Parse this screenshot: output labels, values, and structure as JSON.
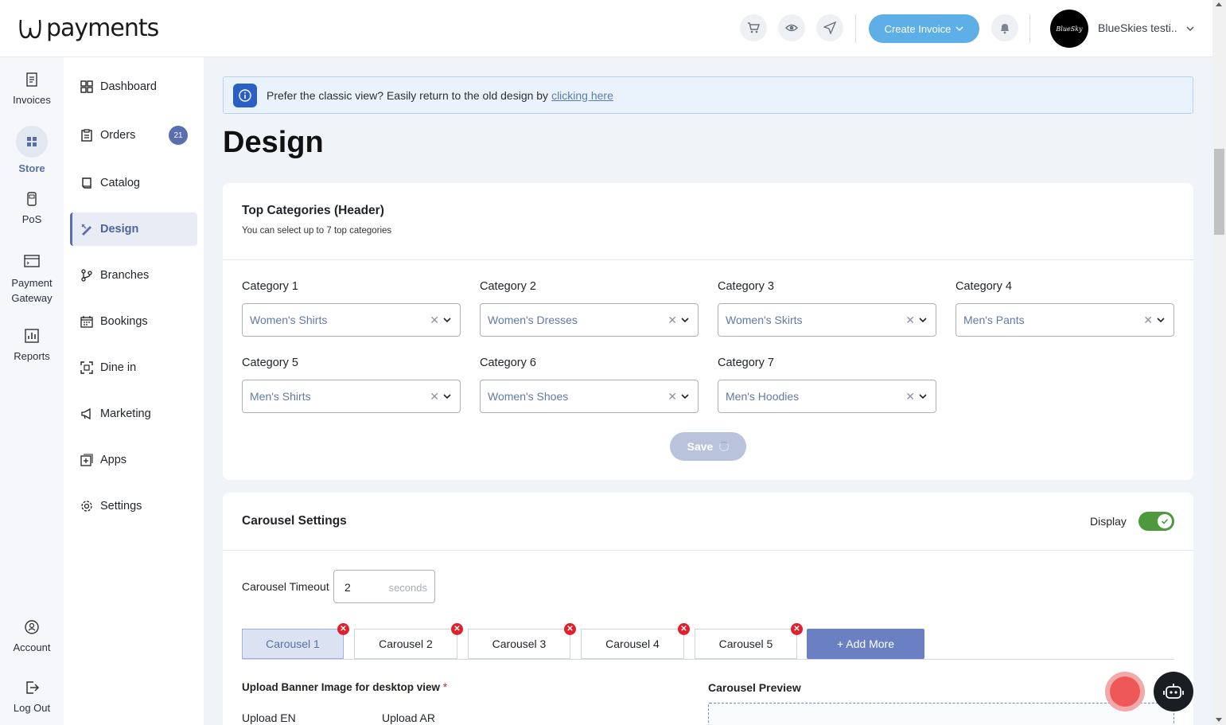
{
  "app": {
    "logo_text": "payments",
    "create_invoice_label": "Create Invoice",
    "account_avatar_text": "BlueSky",
    "account_name": "BlueSkies testi..."
  },
  "rail": {
    "items": [
      {
        "label": "Invoices",
        "icon": "invoices-icon"
      },
      {
        "label": "Store",
        "icon": "store-icon"
      },
      {
        "label": "PoS",
        "icon": "pos-icon"
      },
      {
        "label": "Payment\nGateway",
        "icon": "payment-gateway-icon"
      },
      {
        "label": "Reports",
        "icon": "reports-icon"
      },
      {
        "label": "Account",
        "icon": "account-icon"
      },
      {
        "label": "Log Out",
        "icon": "logout-icon"
      }
    ],
    "payment_line1": "Payment",
    "payment_line2": "Gateway"
  },
  "subnav": {
    "items": [
      {
        "label": "Dashboard"
      },
      {
        "label": "Orders",
        "badge": "21"
      },
      {
        "label": "Catalog"
      },
      {
        "label": "Design"
      },
      {
        "label": "Branches"
      },
      {
        "label": "Bookings"
      },
      {
        "label": "Dine in"
      },
      {
        "label": "Marketing"
      },
      {
        "label": "Apps"
      },
      {
        "label": "Settings"
      }
    ]
  },
  "banner": {
    "text": "Prefer the classic view? Easily return to the old design by",
    "link": "clicking here"
  },
  "page_title": "Design",
  "top_categories": {
    "title": "Top Categories (Header)",
    "subtitle": "You can select up to 7 top categories",
    "categories": [
      {
        "label": "Category 1",
        "value": "Women's Shirts"
      },
      {
        "label": "Category 2",
        "value": "Women's Dresses"
      },
      {
        "label": "Category 3",
        "value": "Women's Skirts"
      },
      {
        "label": "Category 4",
        "value": "Men's Pants"
      },
      {
        "label": "Category 5",
        "value": "Men's Shirts"
      },
      {
        "label": "Category 6",
        "value": "Women's Shoes"
      },
      {
        "label": "Category 7",
        "value": "Men's Hoodies"
      }
    ],
    "save_label": "Save"
  },
  "carousel": {
    "title": "Carousel Settings",
    "display_label": "Display",
    "display_on": true,
    "timeout_label": "Carousel Timeout",
    "timeout_value": "2",
    "timeout_unit": "seconds",
    "tabs": [
      {
        "label": "Carousel 1"
      },
      {
        "label": "Carousel 2"
      },
      {
        "label": "Carousel 3"
      },
      {
        "label": "Carousel 4"
      },
      {
        "label": "Carousel 5"
      }
    ],
    "add_more_label": "+ Add More",
    "upload_title": "Upload Banner Image for desktop view",
    "required_mark": "*",
    "upload_en": "Upload EN",
    "upload_ar": "Upload AR",
    "preview_title": "Carousel Preview"
  },
  "colors": {
    "accent": "#5b6fb0",
    "create_button": "#5eaee7",
    "toggle_on": "#4c9a3c",
    "delete": "#e0202c"
  }
}
